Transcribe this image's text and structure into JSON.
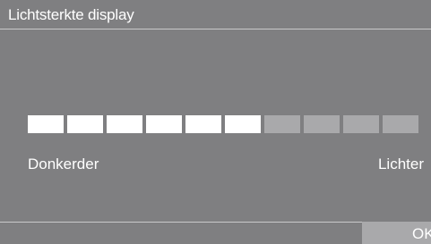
{
  "header": {
    "title": "Lichtsterkte display"
  },
  "brightness": {
    "level": 6,
    "max": 10,
    "min_label": "Donkerder",
    "max_label": "Lichter"
  },
  "footer": {
    "ok_label": "OK"
  },
  "colors": {
    "background": "#7f7f81",
    "segment_filled": "#ffffff",
    "segment_empty": "#a9a9ab",
    "ok_button_bg": "#a9a9ab"
  }
}
